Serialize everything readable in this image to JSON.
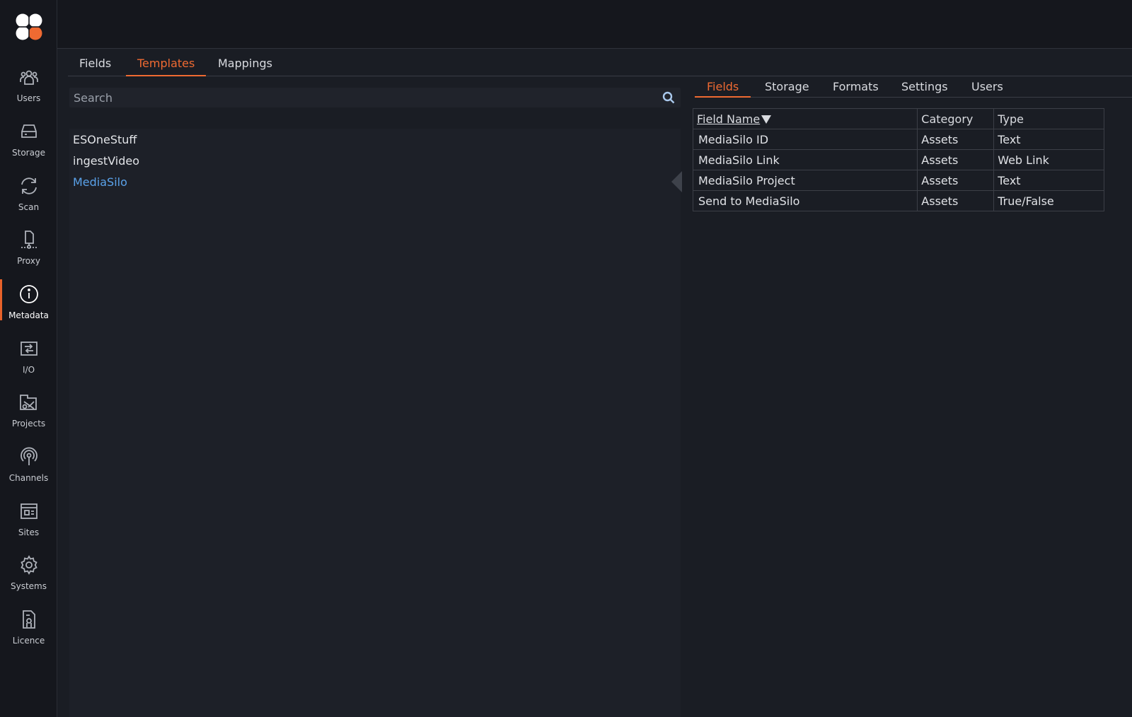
{
  "sidebar": {
    "items": [
      {
        "label": "Users",
        "icon": "users-icon"
      },
      {
        "label": "Storage",
        "icon": "storage-icon"
      },
      {
        "label": "Scan",
        "icon": "scan-icon"
      },
      {
        "label": "Proxy",
        "icon": "proxy-icon"
      },
      {
        "label": "Metadata",
        "icon": "info-icon",
        "active": true
      },
      {
        "label": "I/O",
        "icon": "io-icon"
      },
      {
        "label": "Projects",
        "icon": "projects-icon"
      },
      {
        "label": "Channels",
        "icon": "channels-icon"
      },
      {
        "label": "Sites",
        "icon": "sites-icon"
      },
      {
        "label": "Systems",
        "icon": "gear-icon"
      },
      {
        "label": "Licence",
        "icon": "licence-icon"
      }
    ]
  },
  "main_tabs": [
    {
      "label": "Fields"
    },
    {
      "label": "Templates",
      "active": true
    },
    {
      "label": "Mappings"
    }
  ],
  "search": {
    "placeholder": "Search",
    "value": ""
  },
  "templates": [
    {
      "name": "ESOneStuff"
    },
    {
      "name": "ingestVideo"
    },
    {
      "name": "MediaSilo",
      "selected": true
    }
  ],
  "sub_tabs": [
    {
      "label": "Fields",
      "active": true
    },
    {
      "label": "Storage"
    },
    {
      "label": "Formats"
    },
    {
      "label": "Settings"
    },
    {
      "label": "Users"
    }
  ],
  "table": {
    "headers": {
      "name": "Field Name",
      "category": "Category",
      "type": "Type"
    },
    "rows": [
      {
        "name": "MediaSilo ID",
        "category": "Assets",
        "type": "Text"
      },
      {
        "name": "MediaSilo Link",
        "category": "Assets",
        "type": "Web Link"
      },
      {
        "name": "MediaSilo Project",
        "category": "Assets",
        "type": "Text"
      },
      {
        "name": "Send to MediaSilo",
        "category": "Assets",
        "type": "True/False"
      }
    ]
  },
  "colors": {
    "accent": "#ef6a32",
    "selected": "#5aa2ea",
    "background": "#1a1d24"
  }
}
